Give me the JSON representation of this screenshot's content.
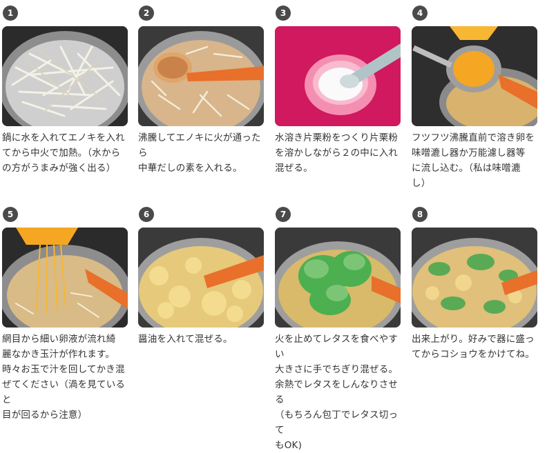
{
  "steps": [
    {
      "number": "1",
      "caption": "鍋に水を入れてエノキを入れ\nてから中火で加熱。（水から\nの方がうまみが強く出る）"
    },
    {
      "number": "2",
      "caption": "沸騰してエノキに火が通ったら\n中華だしの素を入れる。"
    },
    {
      "number": "3",
      "caption": "水溶き片栗粉をつくり片栗粉\nを溶かしながら２の中に入れ\n混ぜる。"
    },
    {
      "number": "4",
      "caption": "フツフツ沸騰直前で溶き卵を\n味噌漉し器か万能濾し器等\nに流し込む。（私は味噌漉\nし）"
    },
    {
      "number": "5",
      "caption": "網目から細い卵液が流れ綺\n麗なかき玉汁が作れます。\n時々お玉で汁を回してかき混\nぜてください（渦を見ていると\n目が回るから注意）"
    },
    {
      "number": "6",
      "caption": "醤油を入れて混ぜる。"
    },
    {
      "number": "7",
      "caption": "火を止めてレタスを食べやすい\n大きさに手でちぎり混ぜる。\n余熱でレタスをしんなりさせる\n（もちろん包丁でレタス切って\nもOK)"
    },
    {
      "number": "8",
      "caption": "出来上がり。好みで器に盛っ\nてからコショウをかけてね。"
    }
  ]
}
